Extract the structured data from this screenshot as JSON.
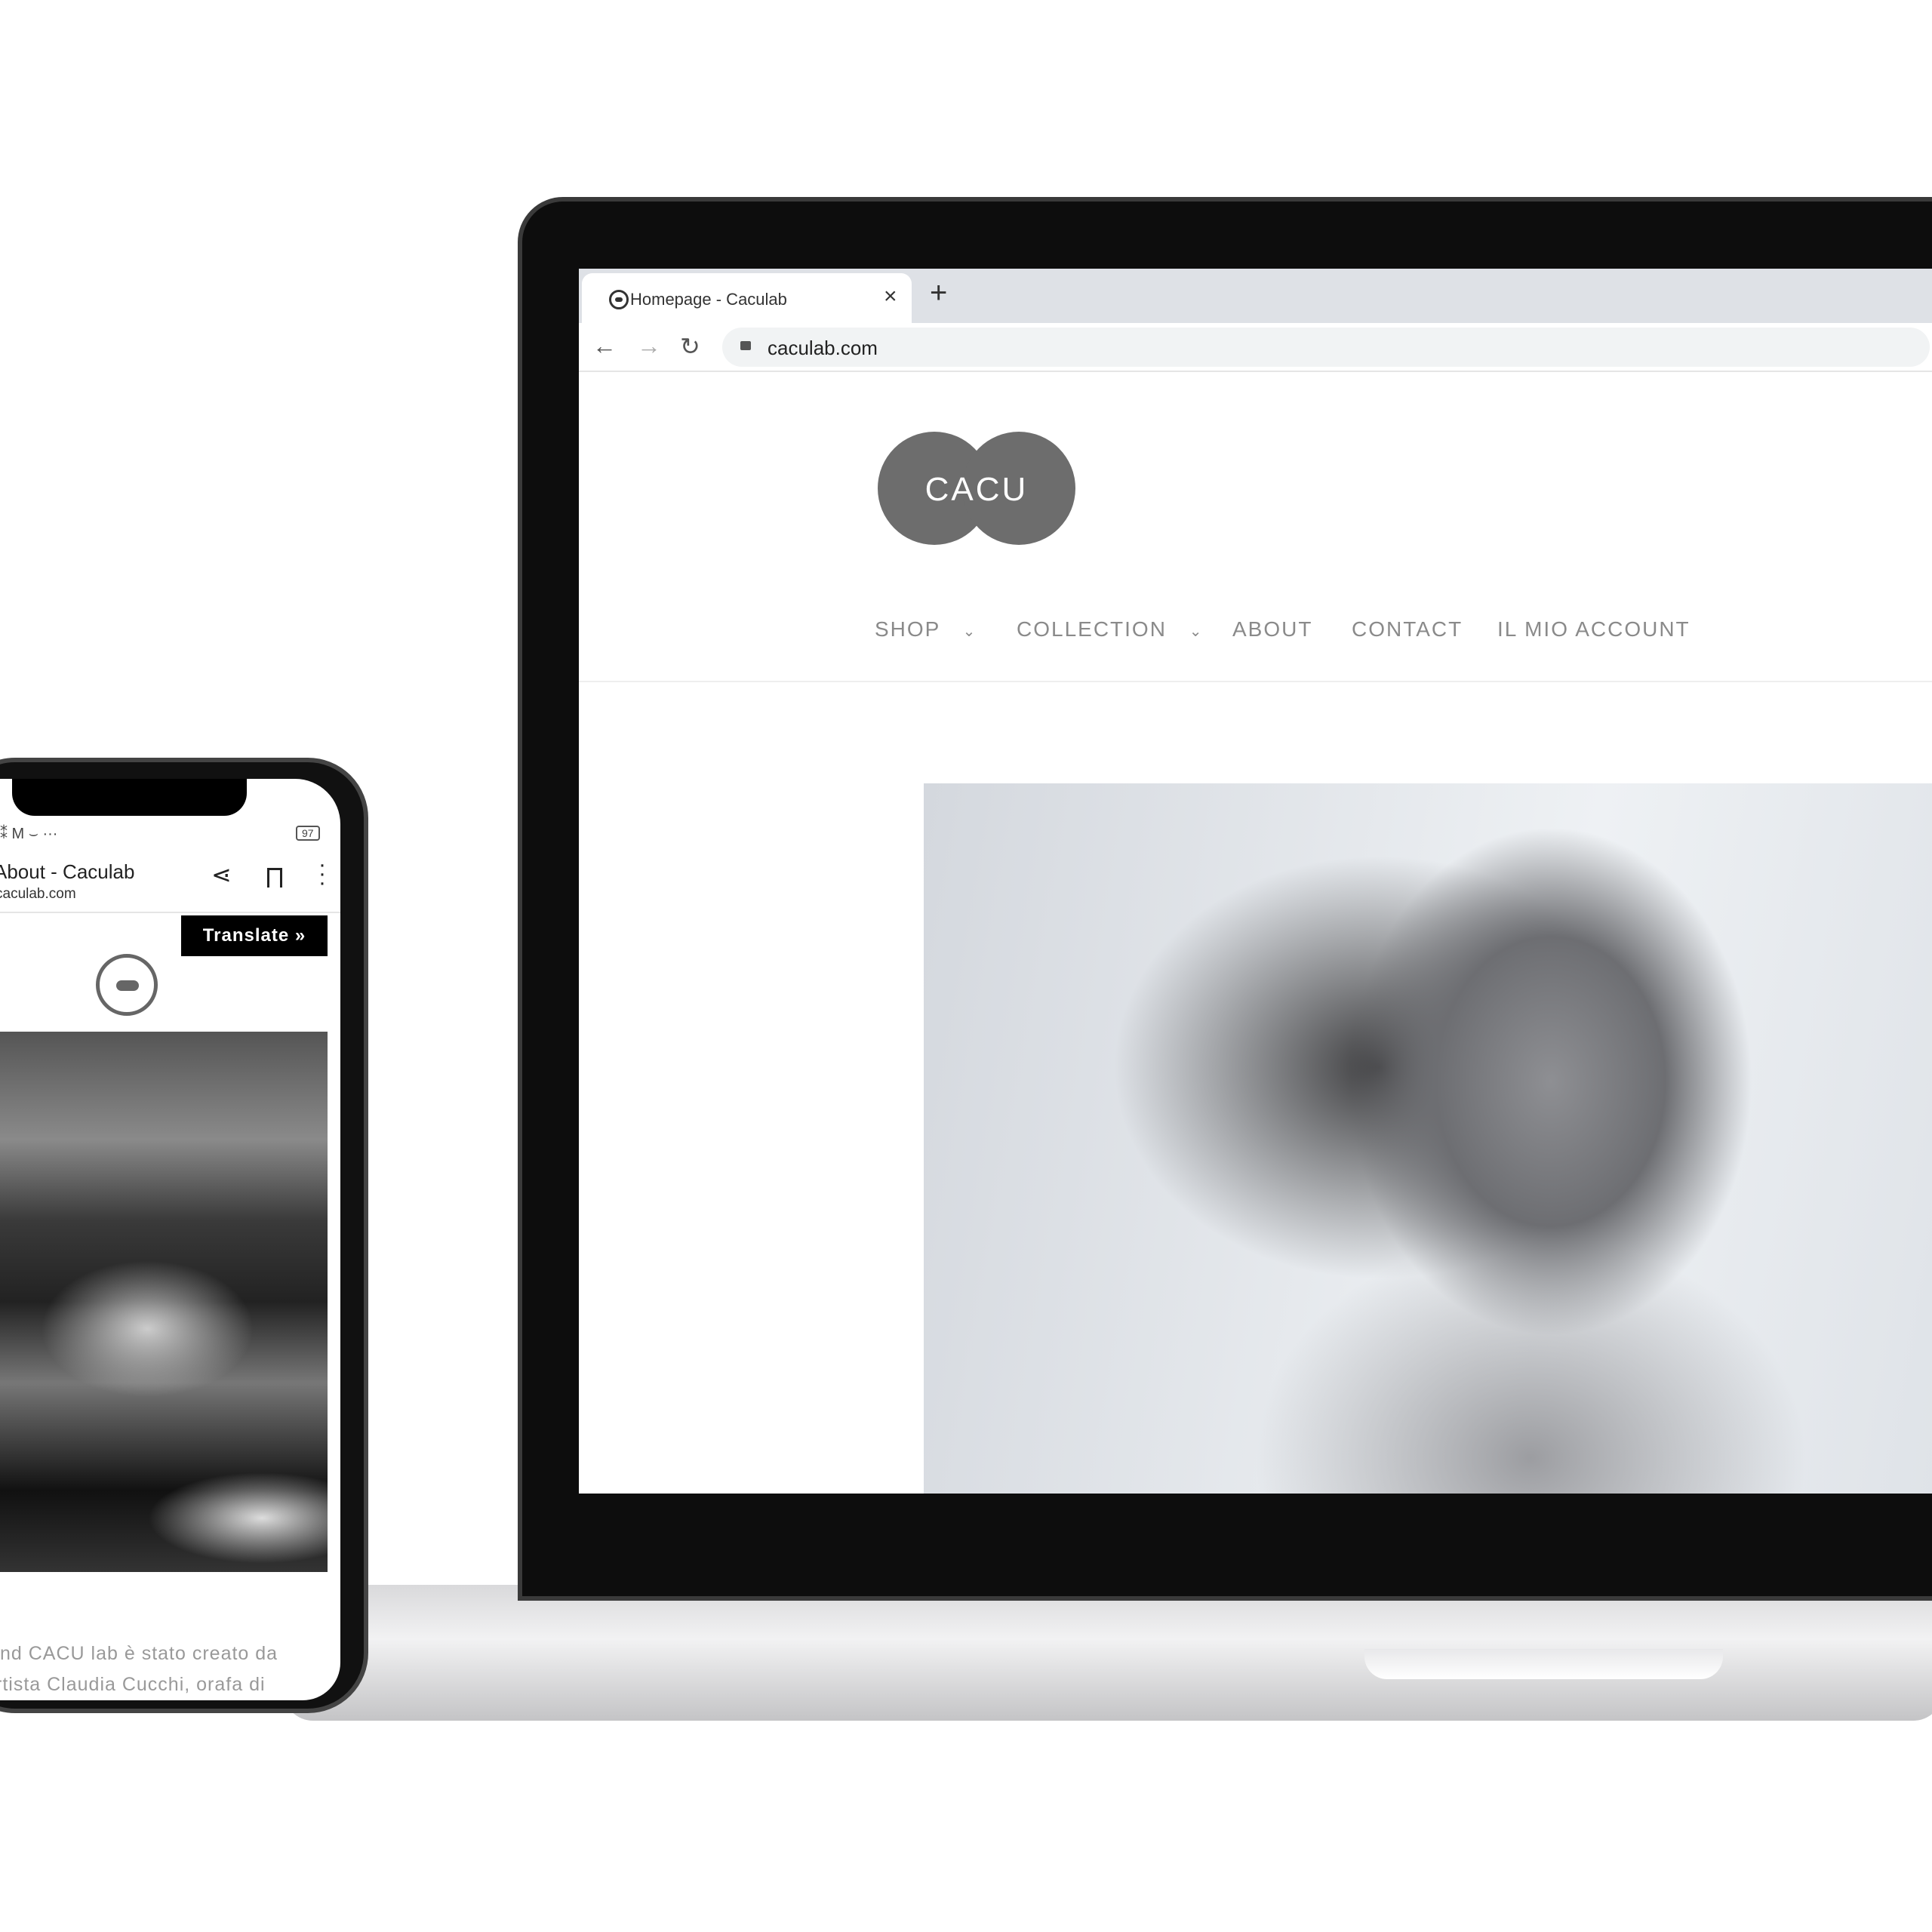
{
  "laptop": {
    "tab_title": "Homepage - Caculab",
    "url": "caculab.com",
    "icons": [
      "favicon-icon",
      "close-icon",
      "plus-icon",
      "back-icon",
      "forward-icon",
      "reload-icon",
      "lock-icon"
    ],
    "logo_text": "CACU",
    "nav": [
      {
        "label": "SHOP",
        "dropdown": true
      },
      {
        "label": "COLLECTION",
        "dropdown": true
      },
      {
        "label": "ABOUT"
      },
      {
        "label": "CONTACT"
      },
      {
        "label": "IL MIO ACCOUNT"
      }
    ]
  },
  "phone": {
    "battery": "97",
    "page_title": "About - Caculab",
    "url": "caculab.com",
    "translate_label": "Translate »",
    "body_lines": [
      "nd CACU lab è stato creato da",
      "rtista Claudia Cucchi, orafa di"
    ]
  },
  "colors": {
    "logo": "#6d6d6d",
    "nav_text": "#8a8a8a",
    "translate_bg": "#000000"
  }
}
